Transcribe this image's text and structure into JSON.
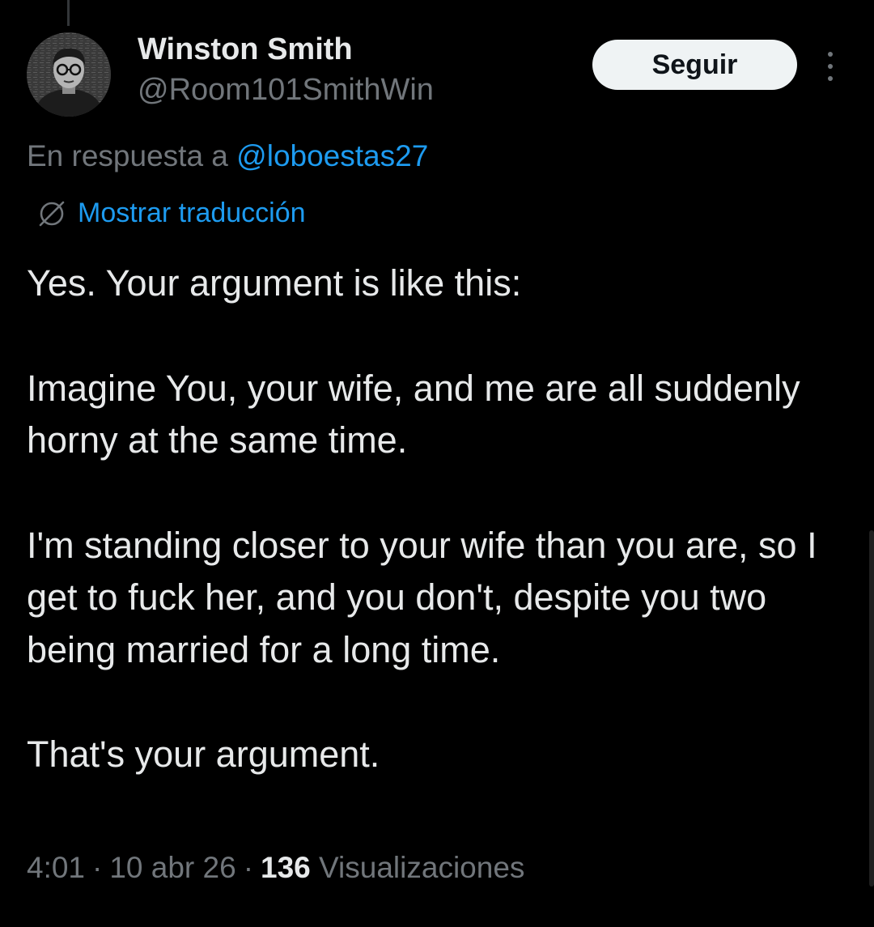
{
  "author": {
    "display_name": "Winston Smith",
    "handle": "@Room101SmithWin",
    "avatar": "avatar-icon"
  },
  "actions": {
    "follow_label": "Seguir",
    "more_icon": "more-vertical-icon"
  },
  "reply": {
    "prefix": "En respuesta a",
    "mention": "@loboestas27"
  },
  "translation": {
    "icon": "globe-icon",
    "label": "Mostrar traducción"
  },
  "tweet": {
    "paragraphs": [
      "Yes. Your argument is like this:",
      "Imagine You, your wife, and me are all suddenly horny at the same time.",
      "I'm standing closer to your wife than you are, so I get to fuck her, and you don't, despite you two being married for a long time.",
      "That's your argument."
    ]
  },
  "meta": {
    "time": "4:01",
    "date": "10 abr 26",
    "views_count": "136",
    "views_label": "Visualizaciones",
    "separator": "·"
  },
  "colors": {
    "background": "#000000",
    "primary_text": "#e7e9ea",
    "secondary_text": "#71767b",
    "accent": "#1d9bf0",
    "follow_button_bg": "#eff3f4"
  }
}
